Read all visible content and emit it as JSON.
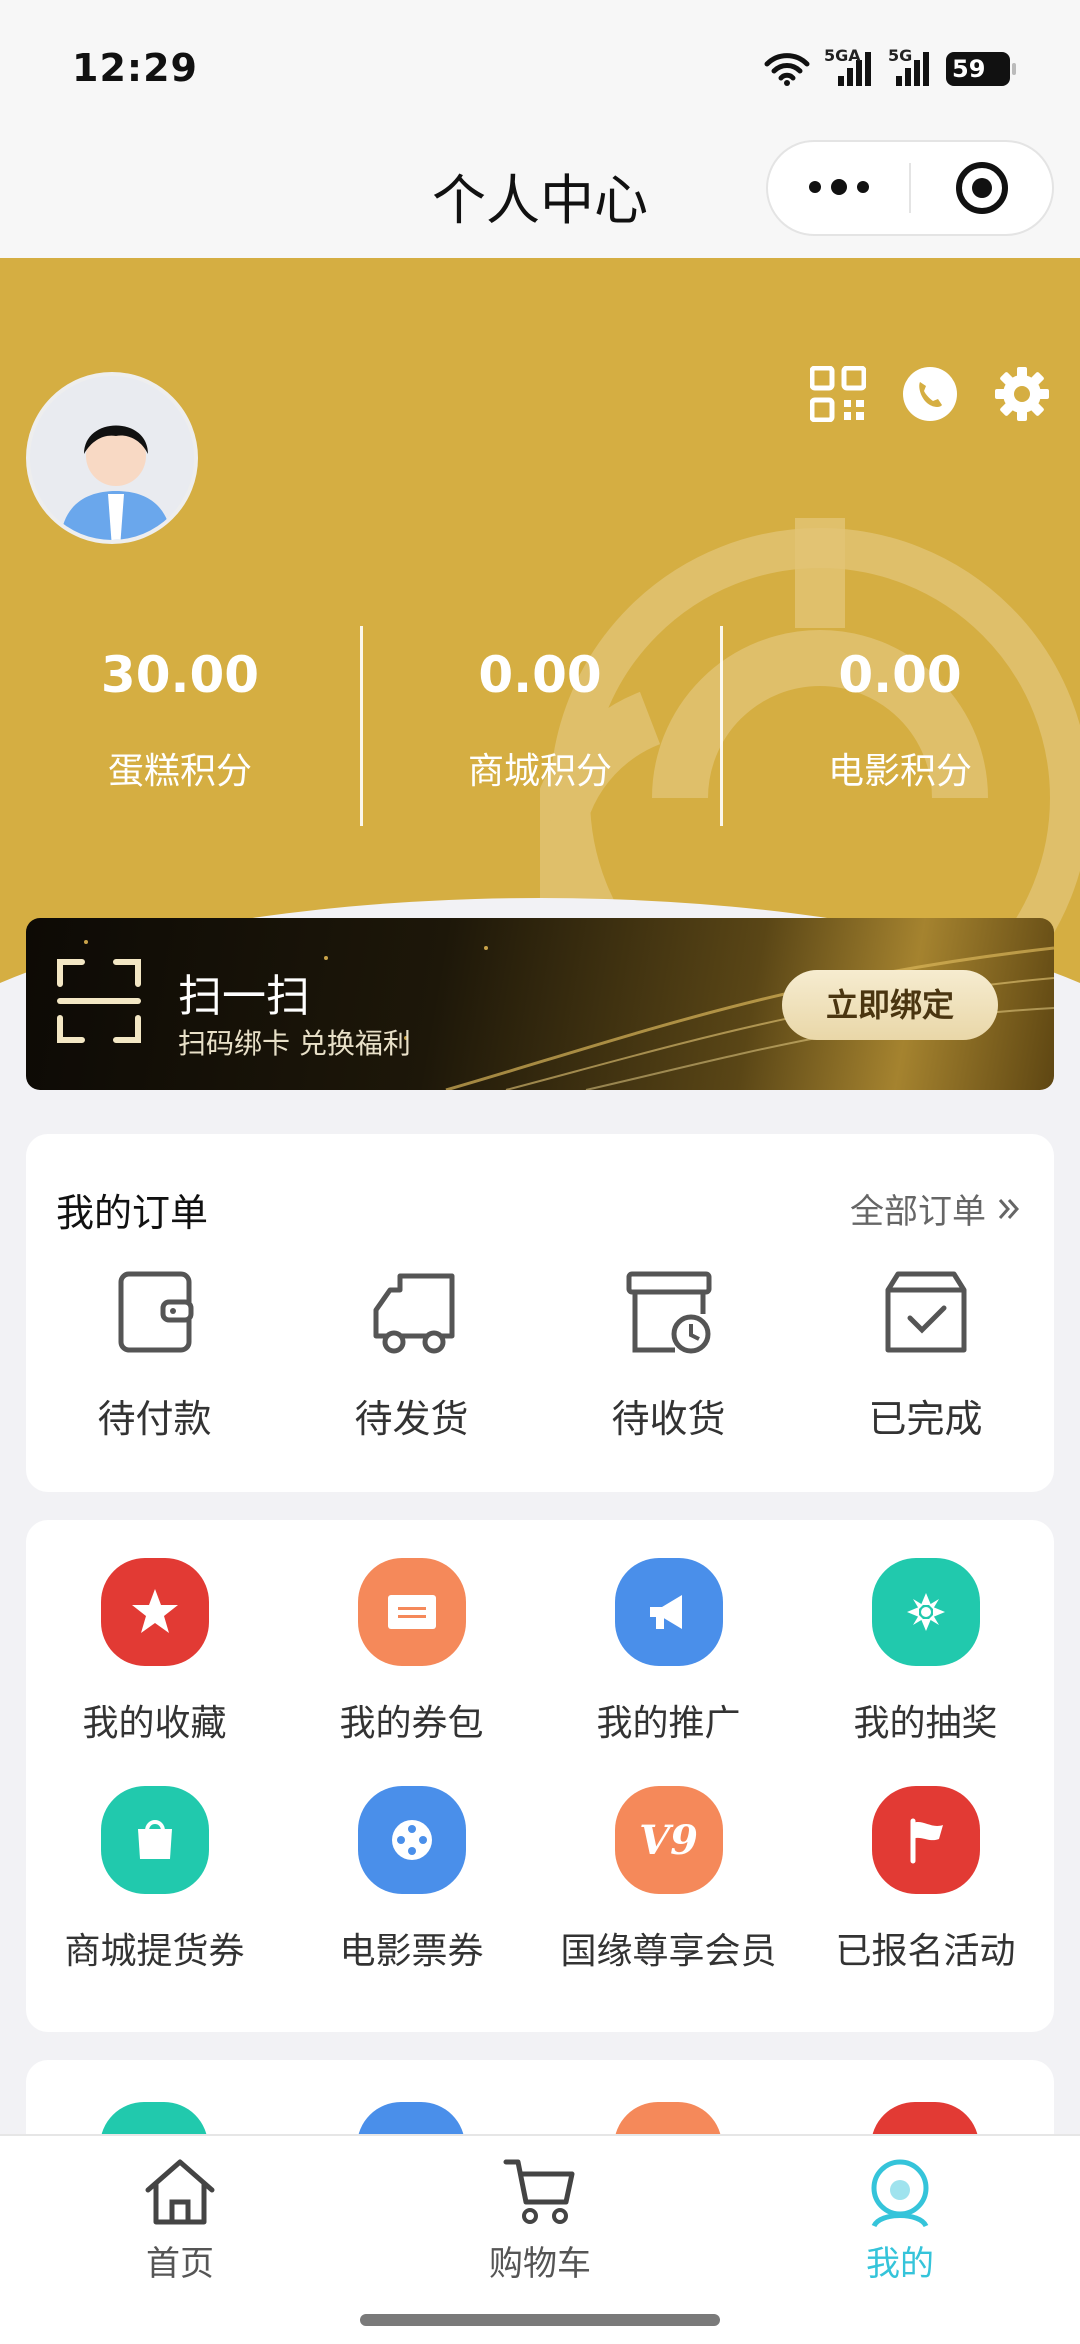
{
  "status_bar": {
    "time": "12:29",
    "signal1": "5GA",
    "signal2": "5G",
    "battery": "59"
  },
  "nav": {
    "title": "个人中心",
    "more_icon": "more-dots-icon",
    "close_icon": "target-circle-icon"
  },
  "header": {
    "background": "#d5ae42",
    "icons": [
      "qrcode-icon",
      "phone-icon",
      "gear-icon"
    ],
    "stats": [
      {
        "value": "30.00",
        "label": "蛋糕积分"
      },
      {
        "value": "0.00",
        "label": "商城积分"
      },
      {
        "value": "0.00",
        "label": "电影积分"
      }
    ]
  },
  "scan": {
    "title": "扫一扫",
    "subtitle": "扫码绑卡 兑换福利",
    "button": "立即绑定"
  },
  "orders": {
    "title": "我的订单",
    "all_link": "全部订单",
    "items": [
      {
        "label": "待付款",
        "icon": "wallet-icon"
      },
      {
        "label": "待发货",
        "icon": "truck-icon"
      },
      {
        "label": "待收货",
        "icon": "clock-box-icon"
      },
      {
        "label": "已完成",
        "icon": "check-box-icon"
      }
    ]
  },
  "services": {
    "items": [
      {
        "label": "我的收藏",
        "icon": "star-icon",
        "color": "#e23a34"
      },
      {
        "label": "我的券包",
        "icon": "coupon-icon",
        "color": "#f5895a"
      },
      {
        "label": "我的推广",
        "icon": "megaphone-icon",
        "color": "#4a8fea"
      },
      {
        "label": "我的抽奖",
        "icon": "pinwheel-icon",
        "color": "#21c9ad"
      },
      {
        "label": "商城提货券",
        "icon": "shopping-bag-icon",
        "color": "#21c9ad"
      },
      {
        "label": "电影票券",
        "icon": "film-reel-icon",
        "color": "#4a8fea"
      },
      {
        "label": "国缘尊享会员",
        "icon": "v9-icon",
        "color": "#f5895a",
        "badge": "V9"
      },
      {
        "label": "已报名活动",
        "icon": "flag-icon",
        "color": "#e23a34"
      }
    ]
  },
  "tabs": [
    {
      "label": "首页",
      "icon": "home-icon"
    },
    {
      "label": "购物车",
      "icon": "cart-icon"
    },
    {
      "label": "我的",
      "icon": "profile-icon",
      "active": true
    }
  ],
  "accent": "#35c4da"
}
